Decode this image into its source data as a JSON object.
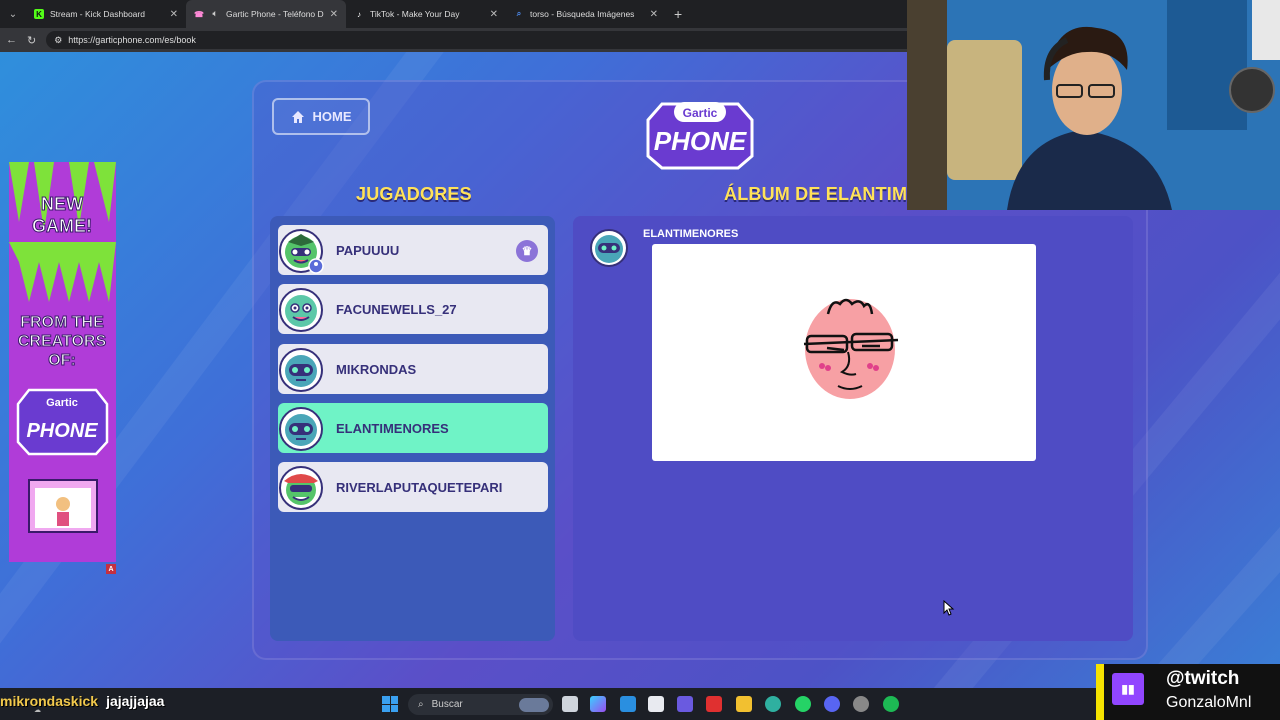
{
  "browser": {
    "tabs": [
      {
        "title": "Stream - Kick Dashboard",
        "favicon": "kick-icon",
        "color": "#53fc18"
      },
      {
        "title": "Gartic Phone - Teléfono Desc",
        "favicon": "gartic-icon",
        "color": "#ff8ad8",
        "active": true
      },
      {
        "title": "TikTok - Make Your Day",
        "favicon": "tiktok-icon",
        "color": "#ffffff"
      },
      {
        "title": "torso - Búsqueda Imágenes",
        "favicon": "search-icon",
        "color": "#4e8cf0"
      }
    ],
    "url": "https://garticphone.com/es/book"
  },
  "game": {
    "home_label": "HOME",
    "logo_top": "Gartic",
    "logo_bottom": "PHONE",
    "players_title": "JUGADORES",
    "album_title": "ÁLBUM DE ELANTIM",
    "players": [
      {
        "name": "PAPUUUU",
        "host": true,
        "color": "#55c46a"
      },
      {
        "name": "FACUNEWELLS_27",
        "color": "#5cc8a8"
      },
      {
        "name": "MIKRONDAS",
        "color": "#4aa6b8"
      },
      {
        "name": "ELANTIMENORES",
        "active": true,
        "color": "#4aa6b8"
      },
      {
        "name": "RIVERLAPUTAQUETEPARI",
        "color": "#55c46a"
      }
    ],
    "album_entry": {
      "author": "ELANTIMENORES"
    }
  },
  "ad": {
    "line1": "NEW",
    "line2": "GAME!",
    "line3": "FROM THE",
    "line4": "CREATORS",
    "line5": "OF:",
    "logo_top": "Gartic",
    "logo_bottom": "PHONE",
    "badge": "A"
  },
  "overlay": {
    "chat_user": "mikrondaskick",
    "chat_message": "jajajjajaa",
    "twitch_handle": "@twitch",
    "twitch_name": "GonzaloMnl"
  },
  "taskbar": {
    "search_label": "Buscar"
  },
  "colors": {
    "accent_yellow": "#ffe259",
    "active_player": "#6ff3c6",
    "twitch_purple": "#9146ff"
  }
}
